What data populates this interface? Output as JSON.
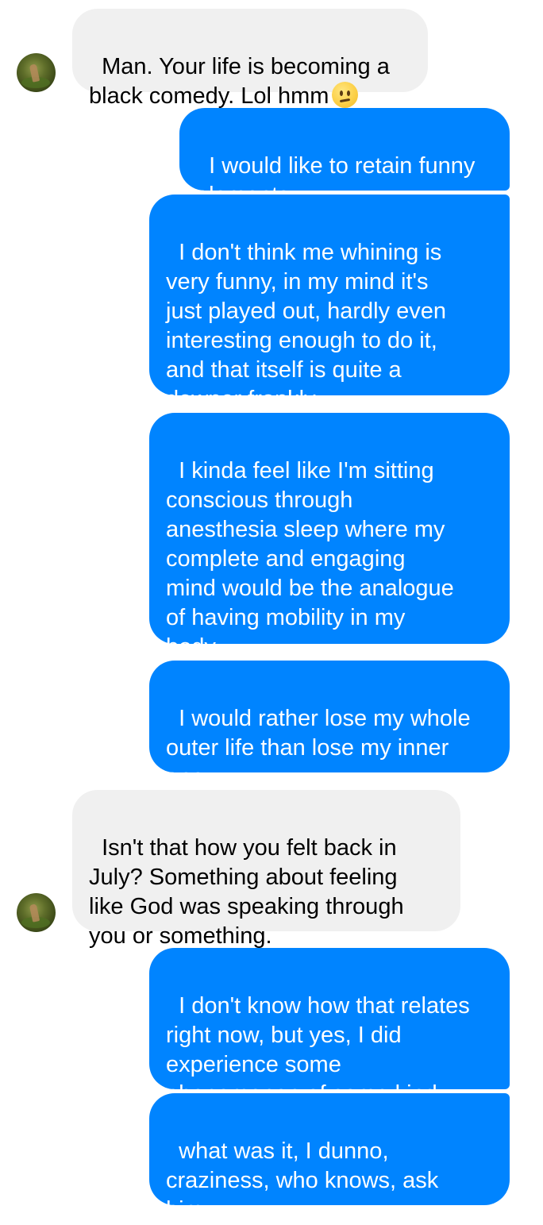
{
  "contact": {
    "avatar_icon": "contact-avatar-icon"
  },
  "messages": [
    {
      "id": "m1",
      "direction": "incoming",
      "text": "Man. Your life is becoming a\nblack comedy. Lol hmm",
      "emoji": "confused-face-emoji"
    },
    {
      "id": "m2",
      "direction": "outgoing",
      "text": "I would like to retain funny\nelements"
    },
    {
      "id": "m3",
      "direction": "outgoing",
      "text": "I don't think me whining is\nvery funny, in my mind it's\njust played out, hardly even\ninteresting enough to do it,\nand that itself is quite a\ndowner frankly"
    },
    {
      "id": "m4",
      "direction": "outgoing",
      "text": "I kinda feel like I'm sitting\nconscious through\nanesthesia sleep where my\ncomplete and engaging\nmind would be the analogue\nof having mobility in my\nbody"
    },
    {
      "id": "m5",
      "direction": "outgoing",
      "text": "I would rather lose my whole\nouter life than lose my inner\none"
    },
    {
      "id": "m6",
      "direction": "incoming",
      "text": "Isn't that how you felt back in\nJuly? Something about feeling\nlike God was speaking through\nyou or something."
    },
    {
      "id": "m7",
      "direction": "outgoing",
      "text": "I don't know how that relates\nright now, but yes, I did\nexperience some\nphenomenon of some kind"
    },
    {
      "id": "m8",
      "direction": "outgoing",
      "text": "what was it, I dunno,\ncraziness, who knows, ask\nhim"
    }
  ],
  "colors": {
    "outgoing_bubble": "#0084ff",
    "incoming_bubble": "#f0f0f0",
    "outgoing_text": "#ffffff",
    "incoming_text": "#000000"
  }
}
